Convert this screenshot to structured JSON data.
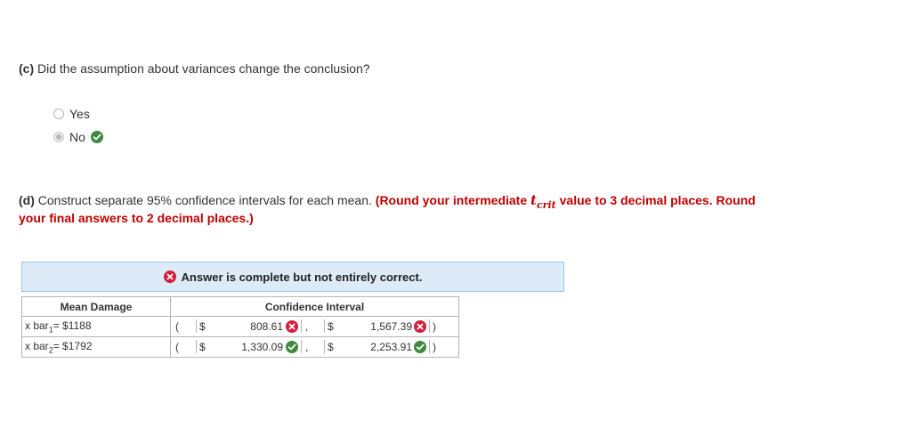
{
  "part_c": {
    "letter": "(c)",
    "question": "Did the assumption about variances change the conclusion?",
    "options": [
      {
        "label": "Yes",
        "selected": false
      },
      {
        "label": "No",
        "selected": true,
        "mark": "check-icon"
      }
    ]
  },
  "part_d": {
    "letter": "(d)",
    "question": "Construct separate 95% confidence intervals for each mean.",
    "instruction_prefix": "(Round your intermediate",
    "t_symbol": "t",
    "t_subscript": "crit",
    "instruction_suffix": "value to 3 decimal places. Round",
    "instruction_line2": "your final answers to 2 decimal places.)"
  },
  "banner": {
    "text": "Answer is complete but not entirely correct.",
    "icon": "x-icon"
  },
  "table": {
    "header_mean": "Mean Damage",
    "header_ci": "Confidence Interval",
    "rows": [
      {
        "label_prefix": "x bar",
        "label_sub": "1",
        "label_suffix": "= $1188",
        "open": "(",
        "currency_low": "$",
        "low": "808.61",
        "low_status": "incorrect",
        "comma": ",",
        "currency_high": "$",
        "high": "1,567.39",
        "high_status": "incorrect",
        "close": ")"
      },
      {
        "label_prefix": "x bar",
        "label_sub": "2",
        "label_suffix": "= $1792",
        "open": "(",
        "currency_low": "$",
        "low": "1,330.09",
        "low_status": "correct",
        "comma": ",",
        "currency_high": "$",
        "high": "2,253.91",
        "high_status": "correct",
        "close": ")"
      }
    ]
  },
  "colors": {
    "correct": "#3e8a3e",
    "incorrect": "#d21f3c",
    "instruction": "#c00000",
    "banner_bg": "#dcebf7"
  }
}
